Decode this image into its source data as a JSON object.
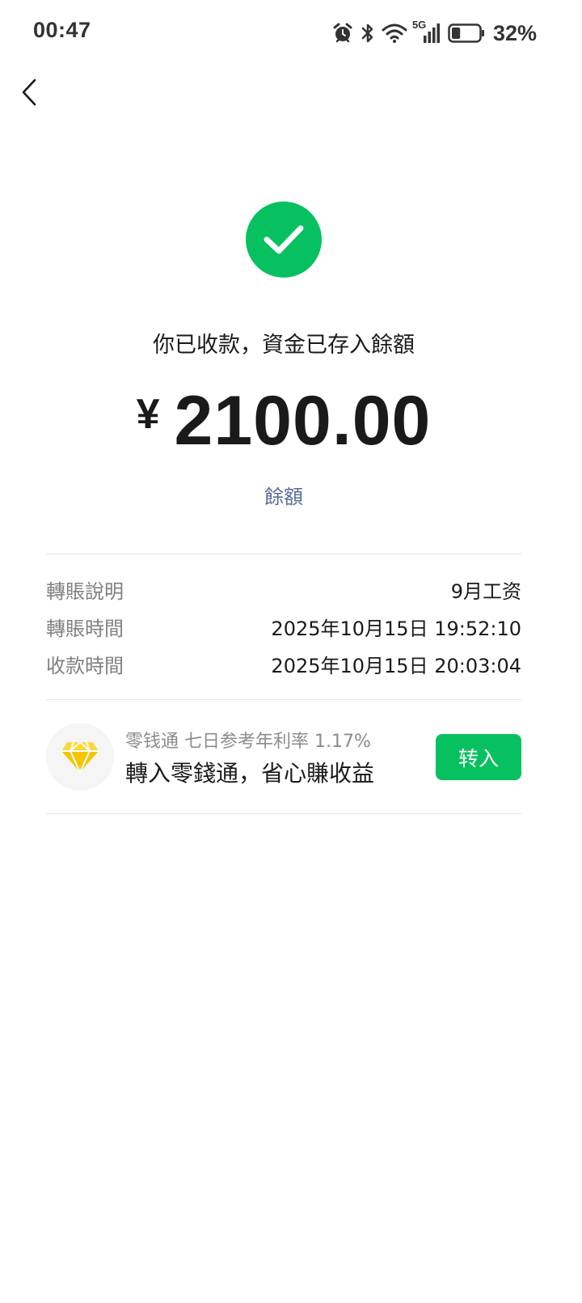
{
  "status_bar": {
    "time": "00:47",
    "network": "5G",
    "battery_percent": "32%",
    "battery_level": 0.32,
    "icons": [
      "alarm-icon",
      "bluetooth-icon",
      "wifi-icon",
      "signal-5g-icon",
      "battery-icon"
    ]
  },
  "header": {
    "back_icon": "chevron-left-icon"
  },
  "result": {
    "icon": "check-circle-icon",
    "message": "你已收款，資金已存入餘額",
    "currency": "¥",
    "amount": "2100.00",
    "balance_link": "餘額"
  },
  "details": [
    {
      "label": "轉賬說明",
      "value": "9月工资"
    },
    {
      "label": "轉賬時間",
      "value": "2025年10月15日 19:52:10"
    },
    {
      "label": "收款時間",
      "value": "2025年10月15日 20:03:04"
    }
  ],
  "promo": {
    "icon": "diamond-icon",
    "subtitle": "零钱通 七日参考年利率 1.17%",
    "title": "轉入零錢通，省心賺收益",
    "button_label": "转入"
  },
  "colors": {
    "accent": "#07c160",
    "link": "#576b95",
    "label_gray": "#808080",
    "diamond": "#f5c400"
  }
}
